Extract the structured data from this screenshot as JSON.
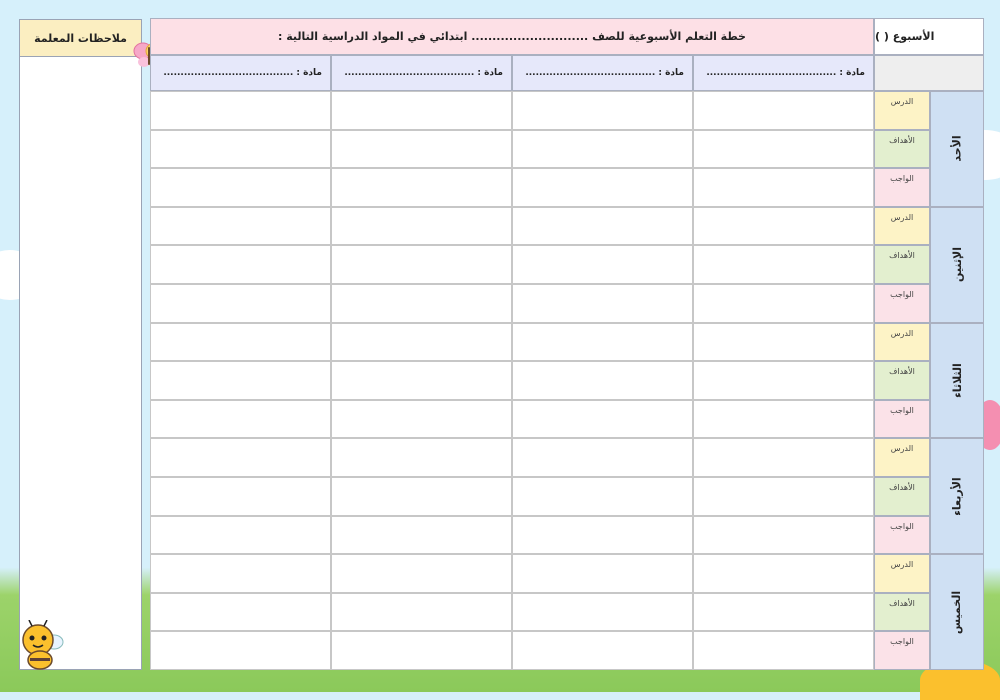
{
  "notes": {
    "title": "ملاحظات المعلمة"
  },
  "header": {
    "week_label": "الأسبوع (      )",
    "title": "خطة التعلم الأسبوعية للصف ............................ ابتدائي في المواد الدراسية التالية :"
  },
  "subjects": [
    "مادة : ......................................",
    "مادة : ......................................",
    "مادة : ......................................",
    "مادة : ......................................"
  ],
  "days": [
    {
      "name": "الأحد",
      "rows": [
        "الدرس",
        "الأهداف",
        "الواجب"
      ]
    },
    {
      "name": "الإثنين",
      "rows": [
        "الدرس",
        "الأهداف",
        "الواجب"
      ]
    },
    {
      "name": "الثلاثاء",
      "rows": [
        "الدرس",
        "الأهداف",
        "الواجب"
      ]
    },
    {
      "name": "الأربعاء",
      "rows": [
        "الدرس",
        "الأهداف",
        "الواجب"
      ]
    },
    {
      "name": "الخميس",
      "rows": [
        "الدرس",
        "الأهداف",
        "الواجب"
      ]
    }
  ],
  "colors": {
    "title_bg": "#fde0e6",
    "subject_bg": "#e6e8fa",
    "day_bg": "#cfe0f3",
    "lesson_bg": "#fdf3c6",
    "goals_bg": "#e3efcf",
    "homework_bg": "#fbe2e8"
  }
}
